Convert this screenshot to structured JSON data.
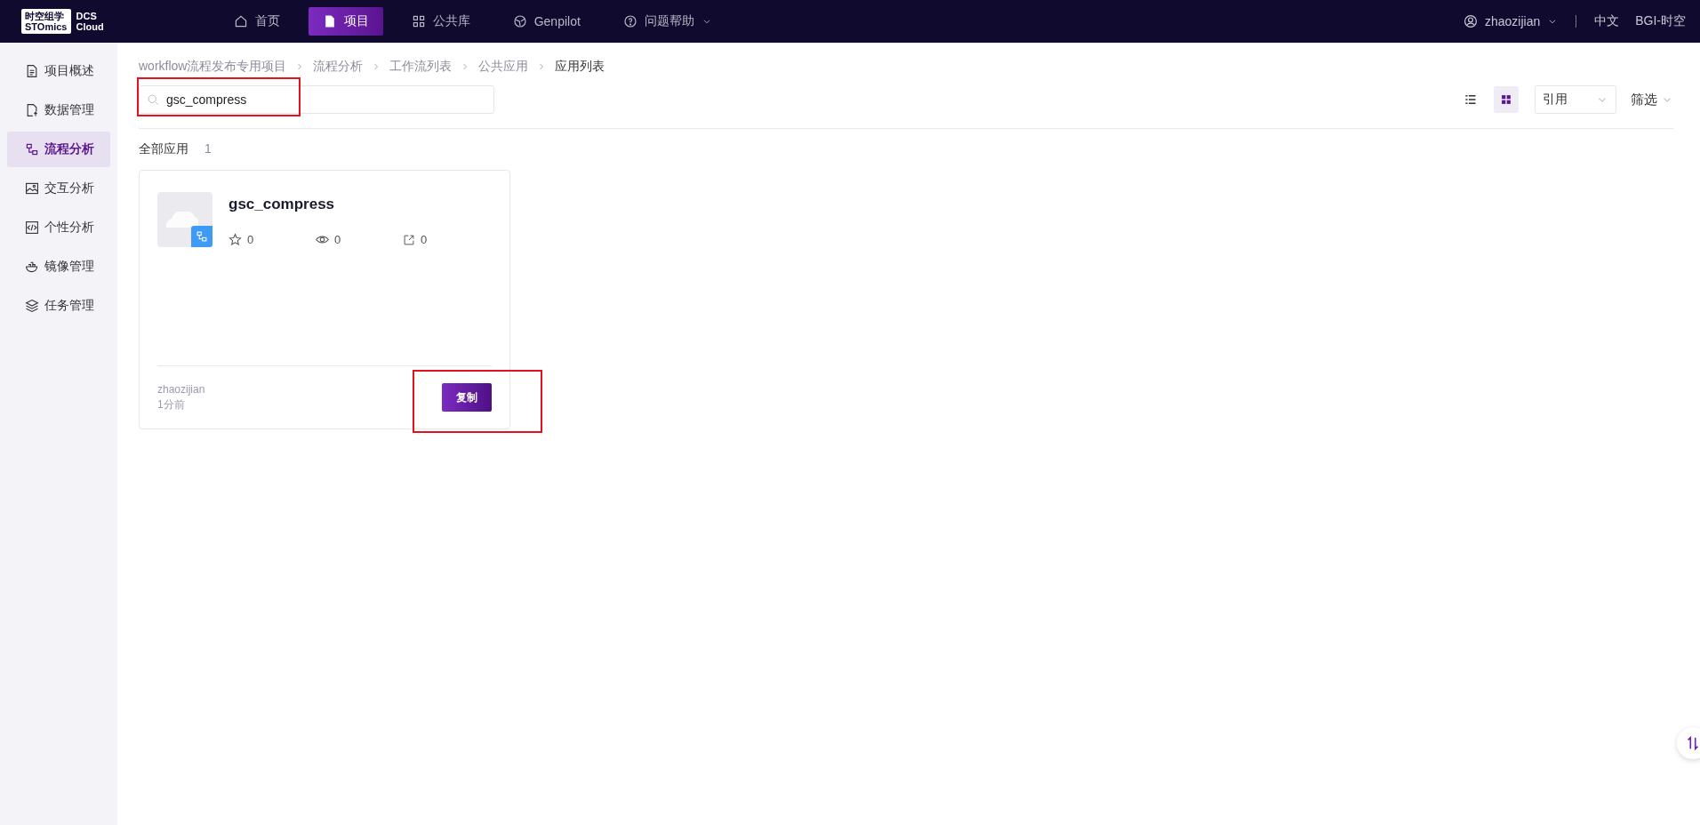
{
  "logo": {
    "cn": "时空组学",
    "en": "STOmics",
    "product_1": "DCS",
    "product_2": "Cloud"
  },
  "top_nav": [
    {
      "label": "首页",
      "selected": false,
      "has_caret": false
    },
    {
      "label": "项目",
      "selected": true,
      "has_caret": false
    },
    {
      "label": "公共库",
      "selected": false,
      "has_caret": false
    },
    {
      "label": "Genpilot",
      "selected": false,
      "has_caret": false
    },
    {
      "label": "问题帮助",
      "selected": false,
      "has_caret": true
    }
  ],
  "user": {
    "name": "zhaozijian",
    "language": "中文",
    "org": "BGI-时空"
  },
  "sidebar": {
    "items": [
      {
        "label": "项目概述",
        "selected": false
      },
      {
        "label": "数据管理",
        "selected": false
      },
      {
        "label": "流程分析",
        "selected": true
      },
      {
        "label": "交互分析",
        "selected": false
      },
      {
        "label": "个性分析",
        "selected": false
      },
      {
        "label": "镜像管理",
        "selected": false
      },
      {
        "label": "任务管理",
        "selected": false
      }
    ]
  },
  "breadcrumb": [
    "workflow流程发布专用项目",
    "流程分析",
    "工作流列表",
    "公共应用",
    "应用列表"
  ],
  "search": {
    "value": "gsc_compress",
    "highlighted": true
  },
  "view_toggle": [
    {
      "kind": "list",
      "selected": false
    },
    {
      "kind": "grid",
      "selected": true
    }
  ],
  "sort_select": {
    "value": "引用"
  },
  "filter": {
    "label": "筛选"
  },
  "summary": {
    "label": "全部应用",
    "count": "1"
  },
  "apps": [
    {
      "name": "gsc_compress",
      "stars": "0",
      "views": "0",
      "shares": "0",
      "author": "zhaozijian",
      "time": "1分前",
      "action": "复制",
      "action_highlighted": true
    }
  ]
}
